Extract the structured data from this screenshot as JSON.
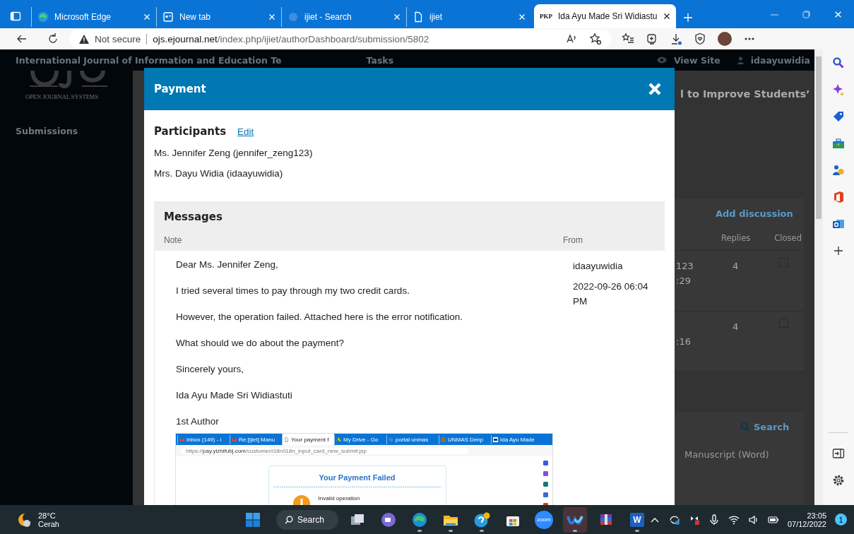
{
  "browser": {
    "tabs": [
      {
        "kind": "edge",
        "title": "Microsoft Edge",
        "selected": false
      },
      {
        "kind": "newtab",
        "title": "New tab",
        "selected": false
      },
      {
        "kind": "search",
        "title": "ijiet - Search",
        "selected": false
      },
      {
        "kind": "page",
        "title": "ijiet",
        "selected": false
      },
      {
        "kind": "pkp",
        "icon_text": "PKP",
        "title": "Ida Ayu Made Sri Widiastu",
        "selected": true
      }
    ],
    "address": {
      "security": "Not secure",
      "host": "ojs.ejournal.net",
      "path": "/index.php/ijiet/authorDashboard/submission/5802"
    }
  },
  "background_page": {
    "journal_title": "International Journal of Information and Education Te",
    "tasks_label": "Tasks",
    "view_site": "View Site",
    "user": "idaayuwidia",
    "logo_caption": "OPEN JOURNAL SYSTEMS",
    "nav_item": "Submissions",
    "submission_title": "l to Improve Students’",
    "discussions": {
      "add": "Add discussion",
      "columns": [
        "Replies",
        "Closed"
      ],
      "rows": [
        {
          "from": "123",
          "time": ":29",
          "replies": "4",
          "closed": false
        },
        {
          "time": ":16",
          "replies": "4",
          "closed": false
        }
      ]
    },
    "files": {
      "search": "Search",
      "file": "Manuscript (Word)"
    }
  },
  "modal": {
    "title": "Payment",
    "participants_label": "Participants",
    "edit_link": "Edit",
    "participants": [
      "Ms. Jennifer Zeng (jennifer_zeng123)",
      "Mrs. Dayu Widia (idaayuwidia)"
    ],
    "messages": {
      "title": "Messages",
      "columns": [
        "Note",
        "From"
      ],
      "rows": [
        {
          "paragraphs": [
            "Dear Ms. Jennifer Zeng,",
            "I tried several times to pay through my two credit cards.",
            "However, the operation failed. Attached here is the error notification.",
            "What should we do about the payment?",
            "Sincerely yours,",
            "Ida Ayu Made Sri Widiastuti",
            "1st Author"
          ],
          "from": "idaayuwidia",
          "date": "2022-09-26 06:04 PM",
          "attachment": {
            "tabs": [
              {
                "kind": "mail",
                "title": "Inbox (149) - i",
                "selected": false
              },
              {
                "kind": "mail",
                "title": "Re:[ijiet] Manu",
                "selected": false
              },
              {
                "kind": "page",
                "title": "Your payment f",
                "selected": true
              },
              {
                "kind": "drive",
                "title": "My Drive - Go",
                "selected": false
              },
              {
                "kind": "blank",
                "title": "portal unmas",
                "selected": false
              },
              {
                "kind": "photo",
                "title": "UNMAS Denp",
                "selected": false
              },
              {
                "kind": "pkp",
                "title": "Ida Ayu Made",
                "selected": false
              }
            ],
            "url": "https://**pay.yizhifubj.com**/customer/i18n/i18n_input_card_new_submit.jsp",
            "heading": "Your Payment Failed",
            "error": "Invalid operation"
          }
        }
      ]
    }
  },
  "taskbar": {
    "weather": {
      "temp": "28°C",
      "condition": "Cerah"
    },
    "search": "Search",
    "apps": [
      {
        "kind": "taskview",
        "running": false,
        "selected": false
      },
      {
        "kind": "chat",
        "running": false,
        "selected": false
      },
      {
        "kind": "edge",
        "running": true,
        "selected": false
      },
      {
        "kind": "explorer",
        "running": true,
        "selected": false
      },
      {
        "kind": "help",
        "running": true,
        "selected": false
      },
      {
        "kind": "store",
        "running": false,
        "selected": false
      },
      {
        "kind": "zoom",
        "icon_text": "zoom",
        "running": false,
        "selected": false
      },
      {
        "kind": "webex",
        "running": true,
        "selected": true
      },
      {
        "kind": "winrar",
        "running": false,
        "selected": false
      },
      {
        "kind": "word",
        "icon_text": "W",
        "running": true,
        "selected": false
      }
    ],
    "time": "23:05",
    "date": "07/12/2022",
    "notifications": "1"
  }
}
